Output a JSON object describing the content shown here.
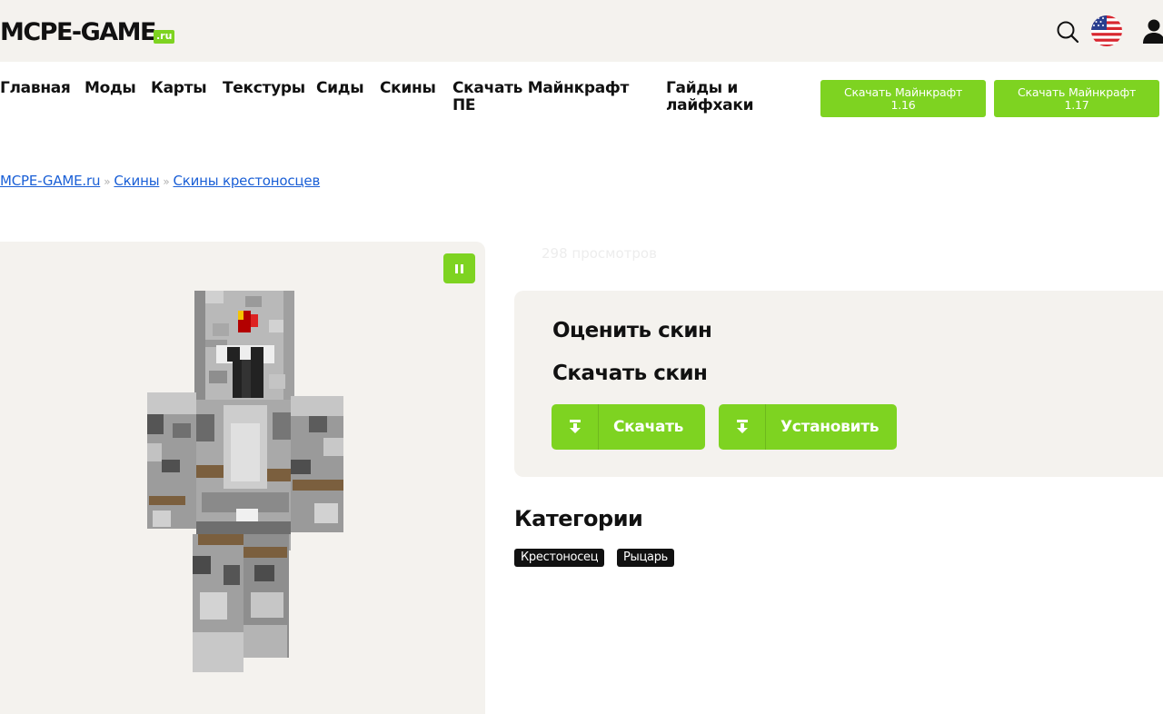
{
  "header": {
    "logo_main": "MCPE-GAME",
    "logo_suffix": ".ru",
    "icons": [
      "search-icon",
      "us-flag-icon",
      "user-icon"
    ]
  },
  "nav": {
    "items": [
      {
        "label": "Главная"
      },
      {
        "label": "Моды"
      },
      {
        "label": "Карты"
      },
      {
        "label": "Текстуры"
      },
      {
        "label": "Сиды"
      },
      {
        "label": "Скины"
      },
      {
        "label_line1": "Скачать Майнкрафт",
        "label_line2": "ПЕ"
      },
      {
        "label_line1": "Гайды и",
        "label_line2": "лайфхаки"
      }
    ],
    "buttons": [
      {
        "line1": "Скачать Майнкрафт",
        "line2": "1.16"
      },
      {
        "line1": "Скачать Майнкрафт",
        "line2": "1.17"
      }
    ]
  },
  "breadcrumb": {
    "items": [
      "MCPE-GAME.ru",
      "Скины",
      "Скины крестоносцев"
    ],
    "separator": "»"
  },
  "skin": {
    "views": "298 просмотров"
  },
  "rate_box": {
    "rate_title": "Оценить скин",
    "download_title": "Скачать скин",
    "download_button": "Скачать",
    "install_button": "Установить"
  },
  "categories": {
    "title": "Категории",
    "tags": [
      "Крестоносец",
      "Рыцарь"
    ]
  },
  "colors": {
    "accent": "#7ed321",
    "panel_bg": "#f4f2ee",
    "link": "#1a5fd6",
    "tag_bg": "#111111"
  }
}
